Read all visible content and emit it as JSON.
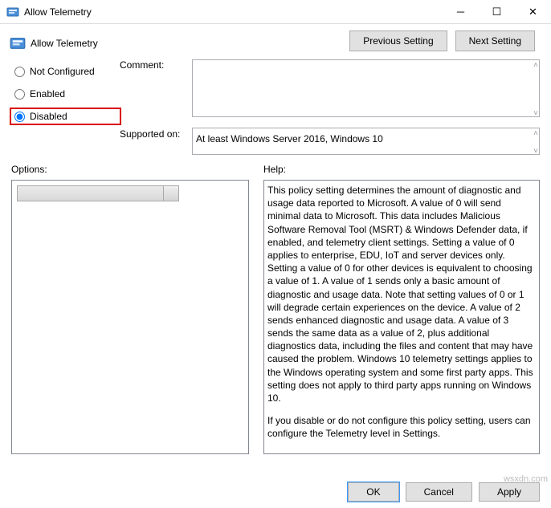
{
  "window": {
    "title": "Allow Telemetry"
  },
  "header": {
    "title": "Allow Telemetry",
    "prev": "Previous Setting",
    "next": "Next Setting"
  },
  "radios": {
    "not_configured": "Not Configured",
    "enabled": "Enabled",
    "disabled": "Disabled"
  },
  "labels": {
    "comment": "Comment:",
    "supported": "Supported on:",
    "options": "Options:",
    "help": "Help:"
  },
  "fields": {
    "comment_value": "",
    "supported_value": "At least Windows Server 2016, Windows 10"
  },
  "help": {
    "p1": "This policy setting determines the amount of diagnostic and usage data reported to Microsoft. A value of 0 will send minimal data to Microsoft. This data includes Malicious Software Removal Tool (MSRT) & Windows Defender data, if enabled, and telemetry client settings. Setting a value of 0 applies to enterprise, EDU, IoT and server devices only. Setting a value of 0 for other devices is equivalent to choosing a value of 1. A value of 1 sends only a basic amount of diagnostic and usage data. Note that setting values of 0 or 1 will degrade certain experiences on the device. A value of 2 sends enhanced diagnostic and usage data. A value of 3 sends the same data as a value of 2, plus additional diagnostics data, including the files and content that may have caused the problem. Windows 10 telemetry settings applies to the Windows operating system and some first party apps. This setting does not apply to third party apps running on Windows 10.",
    "p2": "If you disable or do not configure this policy setting, users can configure the Telemetry level in Settings."
  },
  "buttons": {
    "ok": "OK",
    "cancel": "Cancel",
    "apply": "Apply"
  },
  "watermark": "wsxdn.com"
}
